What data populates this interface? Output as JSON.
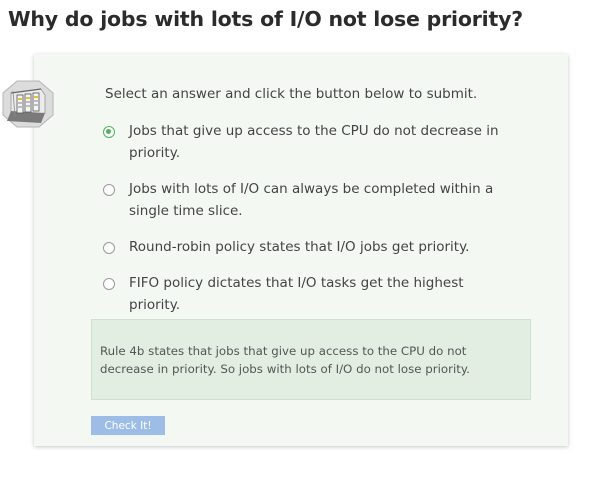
{
  "question": {
    "title": "Why do jobs with lots of I/O not lose priority?"
  },
  "quiz": {
    "instructions": "Select an answer and click the button below to submit.",
    "options": [
      {
        "label": "Jobs that give up access to the CPU do not decrease in priority.",
        "selected": true
      },
      {
        "label": "Jobs with lots of I/O can always be completed within a single time slice.",
        "selected": false
      },
      {
        "label": "Round-robin policy states that I/O jobs get priority.",
        "selected": false
      },
      {
        "label": "FIFO policy dictates that I/O tasks get the highest priority.",
        "selected": false
      }
    ],
    "feedback": "Rule 4b states that jobs that give up access to the CPU do not decrease in priority. So jobs with lots of I/O do not lose priority.",
    "submit_label": "Check It!"
  },
  "colors": {
    "card_background": "#f3f8f3",
    "feedback_background": "#e3eee3",
    "selected_radio": "#52b15f",
    "button_background": "#9dbce6"
  },
  "icons": {
    "mascot": "server-room-icon"
  }
}
